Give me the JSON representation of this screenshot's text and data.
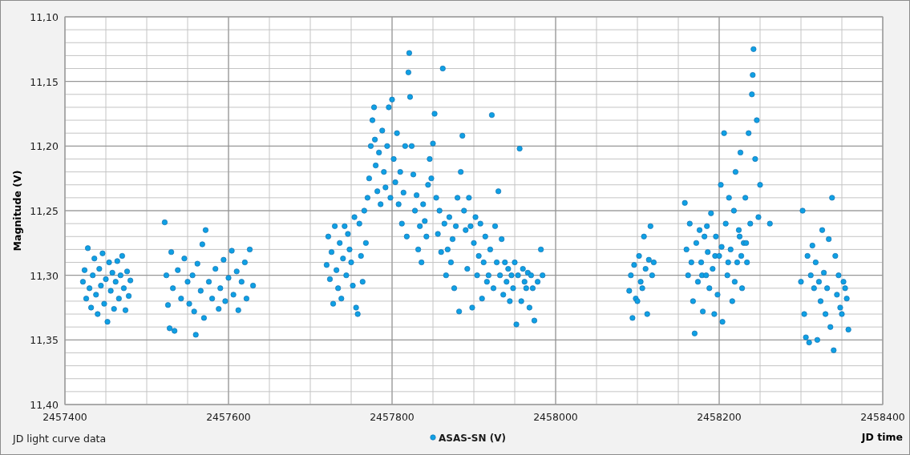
{
  "chart_data": {
    "type": "scatter",
    "grid": true,
    "title": "JD light curve data",
    "xlabel": "JD time",
    "ylabel": "Magnitude (V)",
    "xlim": [
      2457400,
      2458400
    ],
    "ylim": [
      11.4,
      11.1
    ],
    "xticks": [
      2457400,
      2457600,
      2457800,
      2458000,
      2458200,
      2458400
    ],
    "yticks": [
      {
        "value": 11.1,
        "label": "11,10"
      },
      {
        "value": 11.15,
        "label": "11,15"
      },
      {
        "value": 11.2,
        "label": "11,20"
      },
      {
        "value": 11.25,
        "label": "11,25"
      },
      {
        "value": 11.3,
        "label": "11,30"
      },
      {
        "value": 11.35,
        "label": "11,35"
      },
      {
        "value": 11.4,
        "label": "11,40"
      }
    ],
    "x": [
      2457422,
      2457424,
      2457426,
      2457428,
      2457430,
      2457432,
      2457434,
      2457436,
      2457438,
      2457440,
      2457442,
      2457444,
      2457446,
      2457448,
      2457450,
      2457452,
      2457454,
      2457456,
      2457458,
      2457460,
      2457462,
      2457464,
      2457466,
      2457468,
      2457470,
      2457472,
      2457474,
      2457476,
      2457478,
      2457480,
      2457522,
      2457524,
      2457526,
      2457528,
      2457530,
      2457532,
      2457534,
      2457538,
      2457542,
      2457546,
      2457550,
      2457552,
      2457556,
      2457558,
      2457560,
      2457562,
      2457566,
      2457568,
      2457570,
      2457572,
      2457576,
      2457580,
      2457584,
      2457588,
      2457590,
      2457594,
      2457596,
      2457600,
      2457604,
      2457606,
      2457610,
      2457612,
      2457616,
      2457620,
      2457622,
      2457626,
      2457630,
      2457720,
      2457722,
      2457724,
      2457726,
      2457728,
      2457730,
      2457732,
      2457734,
      2457736,
      2457738,
      2457740,
      2457742,
      2457744,
      2457746,
      2457748,
      2457750,
      2457752,
      2457754,
      2457756,
      2457758,
      2457760,
      2457762,
      2457764,
      2457766,
      2457768,
      2457770,
      2457772,
      2457774,
      2457776,
      2457778,
      2457779,
      2457780,
      2457782,
      2457784,
      2457786,
      2457788,
      2457790,
      2457792,
      2457794,
      2457796,
      2457798,
      2457800,
      2457802,
      2457804,
      2457806,
      2457808,
      2457810,
      2457812,
      2457814,
      2457816,
      2457818,
      2457820,
      2457821,
      2457822,
      2457824,
      2457826,
      2457828,
      2457830,
      2457832,
      2457834,
      2457836,
      2457838,
      2457840,
      2457842,
      2457844,
      2457846,
      2457848,
      2457850,
      2457852,
      2457854,
      2457856,
      2457858,
      2457860,
      2457862,
      2457864,
      2457866,
      2457868,
      2457870,
      2457872,
      2457874,
      2457876,
      2457878,
      2457880,
      2457882,
      2457884,
      2457886,
      2457888,
      2457890,
      2457892,
      2457894,
      2457896,
      2457898,
      2457900,
      2457902,
      2457904,
      2457906,
      2457908,
      2457910,
      2457912,
      2457914,
      2457916,
      2457918,
      2457920,
      2457922,
      2457924,
      2457926,
      2457928,
      2457930,
      2457932,
      2457934,
      2457936,
      2457938,
      2457940,
      2457942,
      2457944,
      2457946,
      2457948,
      2457950,
      2457952,
      2457954,
      2457956,
      2457958,
      2457960,
      2457962,
      2457964,
      2457966,
      2457968,
      2457970,
      2457972,
      2457974,
      2457978,
      2457982,
      2457984,
      2458090,
      2458092,
      2458094,
      2458096,
      2458098,
      2458100,
      2458102,
      2458104,
      2458106,
      2458108,
      2458110,
      2458112,
      2458114,
      2458116,
      2458118,
      2458120,
      2458158,
      2458160,
      2458162,
      2458164,
      2458166,
      2458168,
      2458170,
      2458172,
      2458174,
      2458176,
      2458178,
      2458179,
      2458180,
      2458182,
      2458184,
      2458185,
      2458186,
      2458188,
      2458190,
      2458192,
      2458194,
      2458195,
      2458196,
      2458198,
      2458200,
      2458202,
      2458203,
      2458204,
      2458206,
      2458208,
      2458210,
      2458211,
      2458212,
      2458214,
      2458216,
      2458218,
      2458219,
      2458220,
      2458222,
      2458224,
      2458225,
      2458226,
      2458227,
      2458228,
      2458230,
      2458232,
      2458233,
      2458234,
      2458236,
      2458238,
      2458240,
      2458241,
      2458242,
      2458244,
      2458246,
      2458248,
      2458250,
      2458262,
      2458300,
      2458302,
      2458304,
      2458306,
      2458308,
      2458310,
      2458312,
      2458314,
      2458316,
      2458318,
      2458320,
      2458322,
      2458324,
      2458326,
      2458328,
      2458330,
      2458332,
      2458334,
      2458336,
      2458338,
      2458340,
      2458342,
      2458344,
      2458346,
      2458348,
      2458350,
      2458352,
      2458354,
      2458356,
      2458358
    ],
    "series": [
      {
        "name": "ASAS-SN (V)",
        "color": "#0ea0e4",
        "values": [
          11.305,
          11.296,
          11.318,
          11.279,
          11.31,
          11.325,
          11.3,
          11.287,
          11.315,
          11.33,
          11.295,
          11.308,
          11.283,
          11.322,
          11.303,
          11.336,
          11.29,
          11.312,
          11.298,
          11.326,
          11.305,
          11.289,
          11.318,
          11.3,
          11.285,
          11.31,
          11.327,
          11.297,
          11.316,
          11.304,
          11.259,
          11.3,
          11.323,
          11.341,
          11.282,
          11.31,
          11.343,
          11.296,
          11.318,
          11.287,
          11.305,
          11.322,
          11.3,
          11.328,
          11.346,
          11.291,
          11.312,
          11.276,
          11.333,
          11.265,
          11.305,
          11.318,
          11.295,
          11.326,
          11.31,
          11.288,
          11.32,
          11.302,
          11.281,
          11.315,
          11.297,
          11.327,
          11.305,
          11.29,
          11.318,
          11.28,
          11.308,
          11.292,
          11.27,
          11.303,
          11.282,
          11.322,
          11.262,
          11.296,
          11.31,
          11.275,
          11.318,
          11.287,
          11.262,
          11.3,
          11.268,
          11.28,
          11.29,
          11.308,
          11.255,
          11.325,
          11.33,
          11.26,
          11.285,
          11.305,
          11.25,
          11.275,
          11.24,
          11.225,
          11.2,
          11.18,
          11.17,
          11.195,
          11.215,
          11.235,
          11.205,
          11.245,
          11.188,
          11.22,
          11.232,
          11.2,
          11.17,
          11.24,
          11.164,
          11.21,
          11.228,
          11.19,
          11.245,
          11.22,
          11.26,
          11.236,
          11.2,
          11.27,
          11.143,
          11.128,
          11.162,
          11.2,
          11.222,
          11.25,
          11.238,
          11.28,
          11.262,
          11.29,
          11.245,
          11.258,
          11.27,
          11.23,
          11.21,
          11.225,
          11.198,
          11.175,
          11.24,
          11.268,
          11.25,
          11.282,
          11.14,
          11.26,
          11.3,
          11.28,
          11.255,
          11.29,
          11.272,
          11.31,
          11.262,
          11.24,
          11.328,
          11.22,
          11.192,
          11.25,
          11.265,
          11.295,
          11.24,
          11.262,
          11.325,
          11.275,
          11.255,
          11.3,
          11.285,
          11.26,
          11.318,
          11.29,
          11.27,
          11.305,
          11.3,
          11.28,
          11.176,
          11.31,
          11.262,
          11.29,
          11.235,
          11.3,
          11.272,
          11.315,
          11.29,
          11.305,
          11.295,
          11.32,
          11.3,
          11.31,
          11.29,
          11.338,
          11.3,
          11.202,
          11.32,
          11.295,
          11.305,
          11.31,
          11.298,
          11.325,
          11.3,
          11.31,
          11.335,
          11.305,
          11.28,
          11.3,
          11.312,
          11.3,
          11.333,
          11.292,
          11.318,
          11.32,
          11.285,
          11.305,
          11.31,
          11.27,
          11.295,
          11.33,
          11.288,
          11.262,
          11.3,
          11.29,
          11.244,
          11.28,
          11.3,
          11.26,
          11.29,
          11.32,
          11.345,
          11.275,
          11.305,
          11.265,
          11.29,
          11.3,
          11.328,
          11.27,
          11.3,
          11.262,
          11.282,
          11.31,
          11.252,
          11.295,
          11.33,
          11.285,
          11.27,
          11.315,
          11.285,
          11.23,
          11.278,
          11.336,
          11.19,
          11.26,
          11.3,
          11.29,
          11.24,
          11.28,
          11.32,
          11.25,
          11.305,
          11.22,
          11.29,
          11.265,
          11.27,
          11.205,
          11.285,
          11.31,
          11.275,
          11.24,
          11.275,
          11.29,
          11.19,
          11.26,
          11.16,
          11.145,
          11.125,
          11.21,
          11.18,
          11.255,
          11.23,
          11.26,
          11.305,
          11.25,
          11.33,
          11.348,
          11.285,
          11.352,
          11.3,
          11.277,
          11.31,
          11.29,
          11.35,
          11.305,
          11.32,
          11.265,
          11.298,
          11.33,
          11.31,
          11.272,
          11.34,
          11.24,
          11.358,
          11.285,
          11.315,
          11.3,
          11.325,
          11.33,
          11.305,
          11.31,
          11.318,
          11.342
        ]
      }
    ]
  }
}
